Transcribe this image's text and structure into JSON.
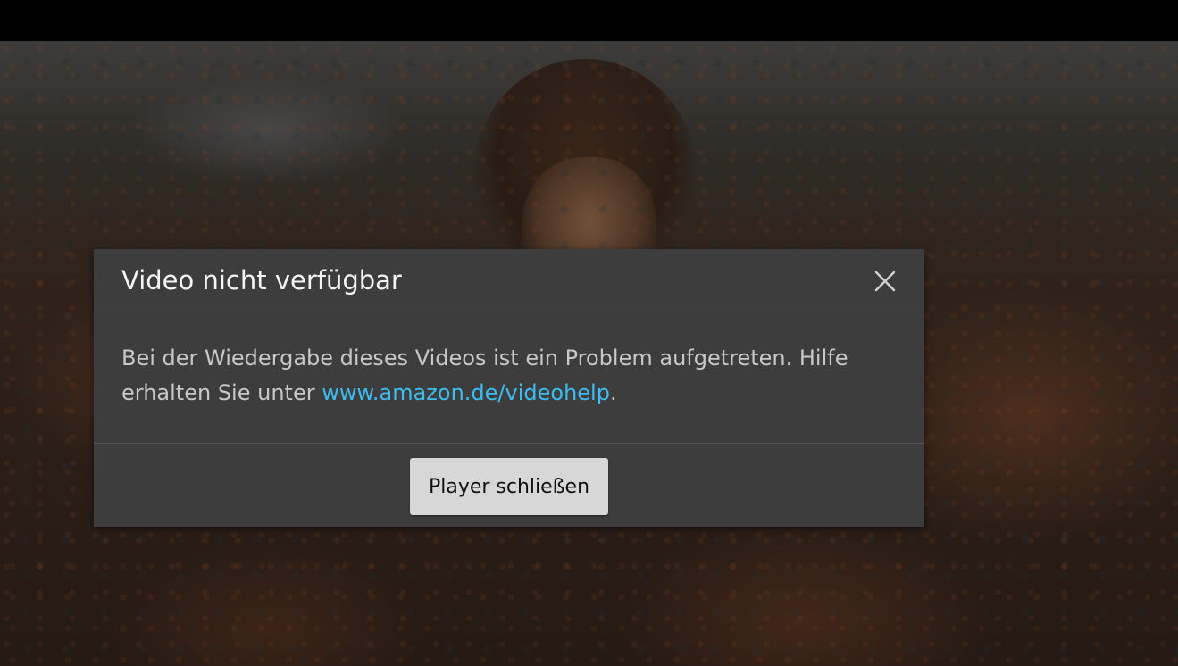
{
  "player": {
    "background_description_colors": {
      "overlay": "#000000",
      "dialog_bg": "#3d3d3d",
      "link_color": "#3dbcf0",
      "button_bg": "#d7d7d7"
    }
  },
  "dialog": {
    "title": "Video nicht verfügbar",
    "close_icon": "close-icon",
    "message_text": "Bei der Wiedergabe dieses Videos ist ein Problem aufgetreten. Hilfe erhalten Sie unter ",
    "link_text": "www.amazon.de/videohelp",
    "message_suffix": ".",
    "button_label": "Player schließen"
  }
}
